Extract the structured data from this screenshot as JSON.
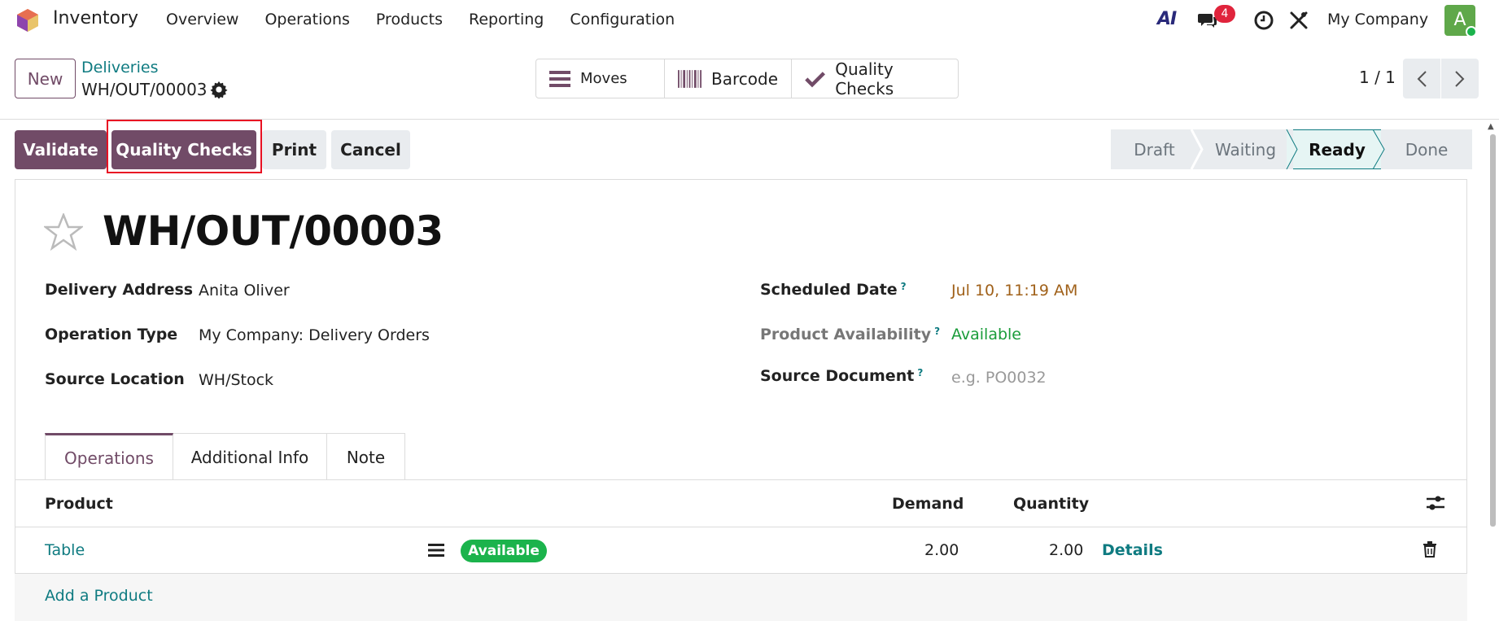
{
  "topnav": {
    "app_name": "Inventory",
    "menu": [
      "Overview",
      "Operations",
      "Products",
      "Reporting",
      "Configuration"
    ],
    "ai_label": "AI",
    "chat_badge": "4",
    "company": "My Company",
    "avatar_initial": "A"
  },
  "control": {
    "new_label": "New",
    "breadcrumb_parent": "Deliveries",
    "breadcrumb_current": "WH/OUT/00003",
    "smart_buttons": [
      "Moves",
      "Barcode",
      "Quality Checks"
    ],
    "pager": "1 / 1"
  },
  "actions": {
    "validate": "Validate",
    "quality_checks": "Quality Checks",
    "print": "Print",
    "cancel": "Cancel"
  },
  "status": {
    "stages": [
      "Draft",
      "Waiting",
      "Ready",
      "Done"
    ],
    "current": "Ready"
  },
  "record": {
    "title": "WH/OUT/00003",
    "fields_left": [
      {
        "label": "Delivery Address",
        "value": "Anita Oliver"
      },
      {
        "label": "Operation Type",
        "value": "My Company: Delivery Orders"
      },
      {
        "label": "Source Location",
        "value": "WH/Stock"
      }
    ],
    "fields_right": [
      {
        "label": "Scheduled Date",
        "value": "Jul 10, 11:19 AM"
      },
      {
        "label": "Product Availability",
        "value": "Available"
      },
      {
        "label": "Source Document",
        "placeholder": "e.g. PO0032"
      }
    ],
    "help_mark": "?"
  },
  "tabs": [
    "Operations",
    "Additional Info",
    "Note"
  ],
  "table": {
    "headers": {
      "product": "Product",
      "demand": "Demand",
      "quantity": "Quantity"
    },
    "rows": [
      {
        "product": "Table",
        "badge": "Available",
        "demand": "2.00",
        "quantity": "2.00",
        "details": "Details"
      }
    ],
    "add_product": "Add a Product"
  },
  "colors": {
    "primary": "#714b67",
    "link": "#0f7b81",
    "success": "#1bb34c",
    "highlight": "#e81123"
  }
}
